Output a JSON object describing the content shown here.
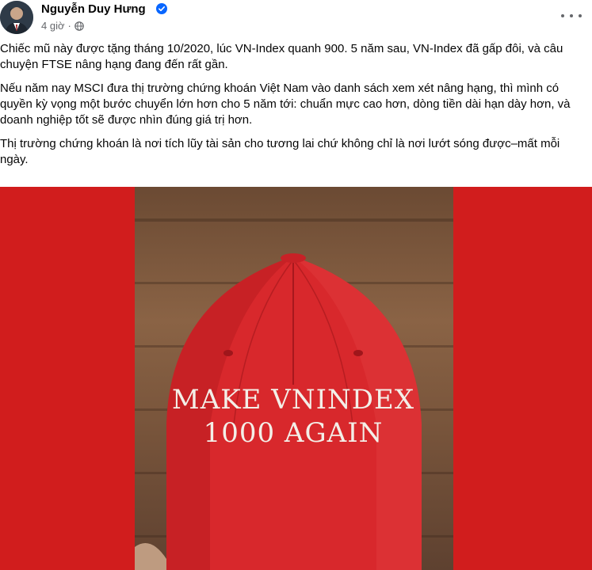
{
  "post": {
    "author": "Nguyễn Duy Hưng",
    "time": "4 giờ",
    "paragraphs": [
      "Chiếc mũ này được tặng tháng 10/2020, lúc VN-Index quanh 900.  5 năm sau, VN-Index đã gấp đôi, và câu chuyện FTSE nâng hạng đang đến rất gần.",
      "Nếu năm nay MSCI đưa thị trường chứng khoán Việt Nam vào danh sách xem xét nâng hạng, thì mình có quyền kỳ vọng một bước chuyển lớn hơn cho 5 năm tới: chuẩn mực cao hơn, dòng tiền dài hạn dày hơn, và doanh nghiệp tốt sẽ được nhìn đúng giá trị hơn.",
      "Thị trường chứng khoán là nơi tích lũy tài sản cho tương lai chứ không chỉ là nơi lướt sóng được–mất mỗi ngày."
    ],
    "photo": {
      "cap_line1": "MAKE VNINDEX",
      "cap_line2": "1000 AGAIN",
      "background_color": "#d11d1d",
      "cap_color": "#d8282c"
    }
  },
  "icons": {
    "verified": "verified-badge-icon",
    "privacy": "globe-icon",
    "more": "more-options-icon"
  },
  "colors": {
    "verified_blue": "#0866ff",
    "meta_gray": "#65676b"
  }
}
